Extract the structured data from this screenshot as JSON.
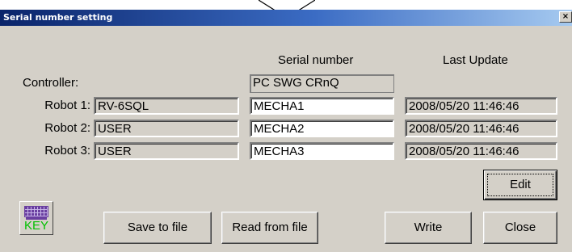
{
  "window": {
    "title": "Serial number setting",
    "close_glyph": "×"
  },
  "headers": {
    "serial": "Serial number",
    "last_update": "Last Update"
  },
  "controller": {
    "label": "Controller:",
    "serial": "PC SWG CRnQ"
  },
  "robots": [
    {
      "label": "Robot 1:",
      "model": "RV-6SQL",
      "serial": "MECHA1",
      "last_update": "2008/05/20 11:46:46"
    },
    {
      "label": "Robot 2:",
      "model": "USER",
      "serial": "MECHA2",
      "last_update": "2008/05/20 11:46:46"
    },
    {
      "label": "Robot 3:",
      "model": "USER",
      "serial": "MECHA3",
      "last_update": "2008/05/20 11:46:46"
    }
  ],
  "buttons": {
    "edit": "Edit",
    "save": "Save to file",
    "read": "Read from file",
    "write": "Write",
    "close": "Close",
    "key": "KEY"
  },
  "colors": {
    "titlebar_start": "#0a246a",
    "titlebar_end": "#a6caf0",
    "face": "#d4d0c8",
    "key_text": "#00c000",
    "keyboard_icon": "#6a3fa0"
  }
}
